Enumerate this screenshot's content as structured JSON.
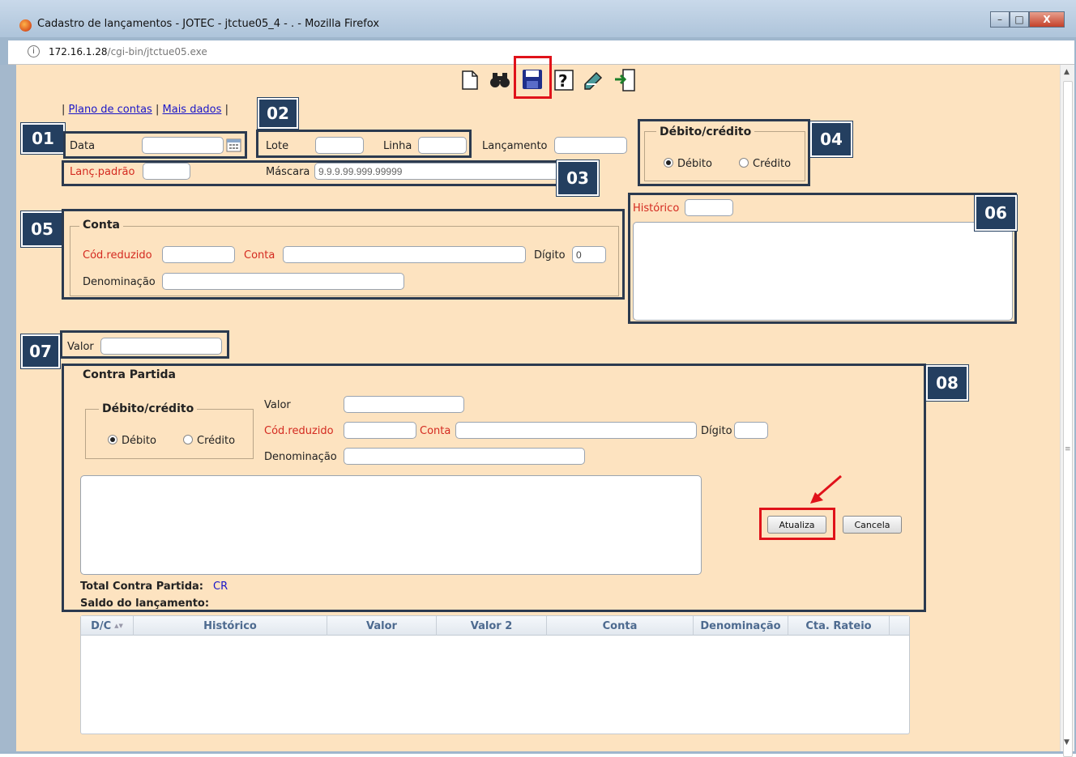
{
  "window": {
    "title": "Cadastro de lançamentos - JOTEC - jtctue05_4 - . - Mozilla Firefox",
    "url_host": "172.16.1.28",
    "url_path": "/cgi-bin/jtctue05.exe",
    "controls": {
      "minimize": "–",
      "maximize": "□",
      "close": "X"
    }
  },
  "toolbar": {
    "icons": [
      "new-document-icon",
      "search-binoculars-icon",
      "save-icon",
      "help-icon",
      "edit-icon",
      "exit-icon"
    ]
  },
  "links": {
    "plano_de_contas": "Plano de contas",
    "mais_dados": "Mais dados",
    "sep_open": "|",
    "sep_mid": "|",
    "sep_close": "|"
  },
  "badges": [
    "01",
    "02",
    "03",
    "04",
    "05",
    "06",
    "07",
    "08"
  ],
  "header": {
    "data_label": "Data",
    "data_value": "",
    "lote_label": "Lote",
    "lote_value": "",
    "linha_label": "Linha",
    "linha_value": "",
    "lancamento_label": "Lançamento",
    "lancamento_value": "",
    "lanc_padrao_label": "Lanç.padrão",
    "lanc_padrao_value": "",
    "mascara_label": "Máscara",
    "mascara_value": "9.9.9.99.999.99999"
  },
  "debito_credito": {
    "legend": "Débito/crédito",
    "debito": "Débito",
    "credito": "Crédito",
    "selected": "Débito"
  },
  "historico": {
    "label": "Histórico",
    "code_value": "",
    "text_value": ""
  },
  "conta": {
    "legend": "Conta",
    "cod_reduzido_label": "Cód.reduzido",
    "cod_reduzido_value": "",
    "conta_label": "Conta",
    "conta_value": "",
    "digito_label": "Dígito",
    "digito_value": "0",
    "denominacao_label": "Denominação",
    "denominacao_value": ""
  },
  "valor": {
    "label": "Valor",
    "value": ""
  },
  "contra_partida": {
    "legend": "Contra Partida",
    "dc_legend": "Débito/crédito",
    "debito": "Débito",
    "credito": "Crédito",
    "valor_label": "Valor",
    "cod_reduzido_label": "Cód.reduzido",
    "conta_label": "Conta",
    "digito_label": "Dígito",
    "denominacao_label": "Denominação",
    "atualiza": "Atualiza",
    "cancela": "Cancela",
    "total_label": "Total Contra Partida:",
    "total_value": "CR",
    "saldo_label": "Saldo do lançamento:",
    "saldo_value": ""
  },
  "table": {
    "columns": [
      "D/C",
      "Histórico",
      "Valor",
      "Valor 2",
      "Conta",
      "Denominação",
      "Cta. Rateio"
    ],
    "sort_indicator": "▲▼",
    "rows": []
  },
  "colors": {
    "badge": "#243f60",
    "highlight": "#e0121a",
    "page_bg": "#fde3c0",
    "required_label": "#d42a20"
  }
}
